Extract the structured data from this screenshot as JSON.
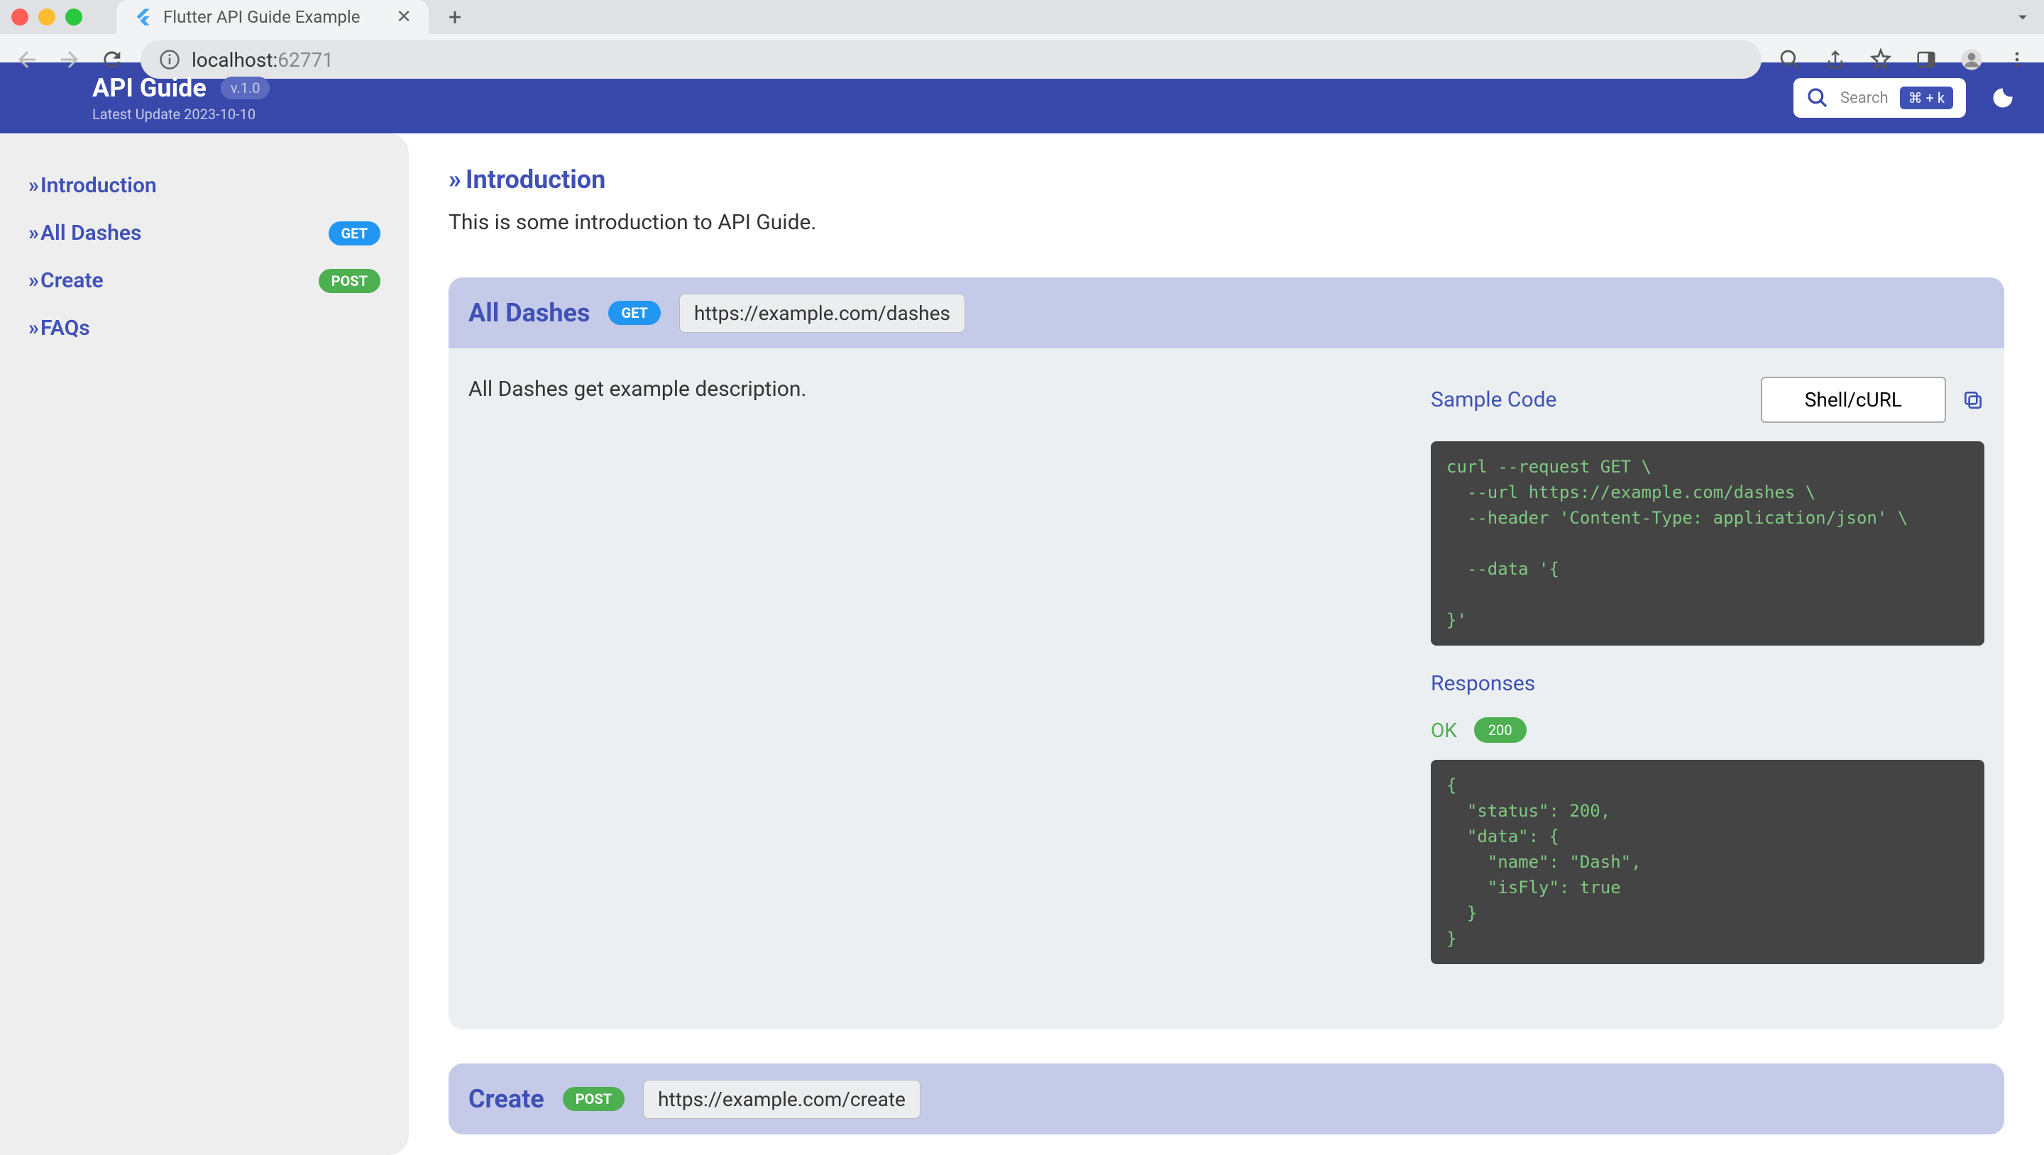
{
  "browser": {
    "tab_title": "Flutter API Guide Example",
    "url_host": "localhost:",
    "url_port": "62771"
  },
  "header": {
    "title": "API Guide",
    "version": "v.1.0",
    "subtitle": "Latest Update 2023-10-10",
    "search_label": "Search",
    "search_keys": "⌘ + k"
  },
  "sidebar": {
    "items": [
      {
        "label": "Introduction",
        "badge": null
      },
      {
        "label": "All Dashes",
        "badge": "GET"
      },
      {
        "label": "Create",
        "badge": "POST"
      },
      {
        "label": "FAQs",
        "badge": null
      }
    ]
  },
  "intro": {
    "title": "Introduction",
    "text": "This is some introduction to API Guide."
  },
  "endpoints": [
    {
      "title": "All Dashes",
      "method": "GET",
      "url": "https://example.com/dashes",
      "description": "All Dashes get example description.",
      "sample_label": "Sample Code",
      "language": "Shell/cURL",
      "code": "curl --request GET \\\n  --url https://example.com/dashes \\\n  --header 'Content-Type: application/json' \\\n\n  --data '{\n\n}'",
      "responses_label": "Responses",
      "response_status_text": "OK",
      "response_status_code": "200",
      "response_body": "{\n  \"status\": 200,\n  \"data\": {\n    \"name\": \"Dash\",\n    \"isFly\": true\n  }\n}"
    },
    {
      "title": "Create",
      "method": "POST",
      "url": "https://example.com/create"
    }
  ]
}
